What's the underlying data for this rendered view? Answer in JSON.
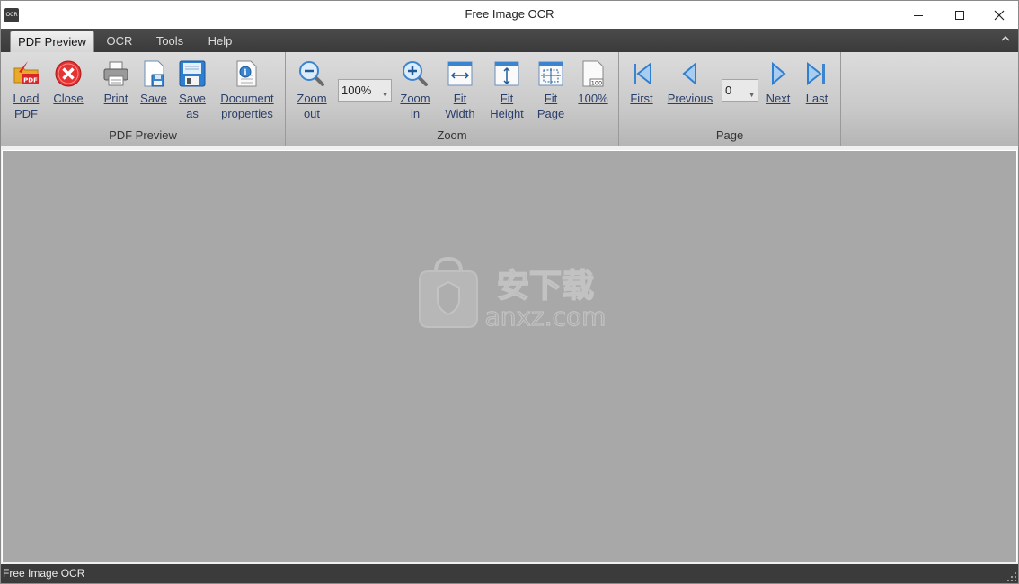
{
  "window": {
    "title": "Free Image OCR",
    "icon_text": "OCR"
  },
  "tabs": [
    {
      "label": "PDF Preview",
      "active": true
    },
    {
      "label": "OCR",
      "active": false
    },
    {
      "label": "Tools",
      "active": false
    },
    {
      "label": "Help",
      "active": false
    }
  ],
  "ribbon": {
    "pdf_preview": {
      "label": "PDF Preview",
      "buttons": {
        "load_pdf": {
          "line1": "Load",
          "line2": "PDF",
          "icon": "load-pdf-icon"
        },
        "close": {
          "line1": "Close",
          "icon": "close-circle-icon"
        },
        "print": {
          "line1": "Print",
          "icon": "printer-icon"
        },
        "save": {
          "line1": "Save",
          "icon": "save-icon"
        },
        "save_as": {
          "line1": "Save",
          "line2": "as",
          "icon": "save-as-icon"
        },
        "doc_props": {
          "line1": "Document",
          "line2": "properties",
          "icon": "document-info-icon"
        }
      }
    },
    "zoom": {
      "label": "Zoom",
      "zoom_out": {
        "line1": "Zoom",
        "line2": "out"
      },
      "zoom_level": "100%",
      "zoom_in": {
        "line1": "Zoom",
        "line2": "in"
      },
      "fit_width": {
        "line1": "Fit",
        "line2": "Width"
      },
      "fit_height": {
        "line1": "Fit",
        "line2": "Height"
      },
      "fit_page": {
        "line1": "Fit",
        "line2": "Page"
      },
      "actual": {
        "line1": "100%",
        "badge": "100"
      }
    },
    "page": {
      "label": "Page",
      "first": "First",
      "previous": "Previous",
      "page_number": "0",
      "next": "Next",
      "last": "Last"
    }
  },
  "watermark": {
    "text1": "安下载",
    "text2": "anxz.com"
  },
  "status": {
    "text": "Free Image OCR"
  },
  "colors": {
    "accent_blue": "#2f7fd0",
    "status_bar": "#3b3b3b",
    "workspace": "#a8a8a8"
  }
}
